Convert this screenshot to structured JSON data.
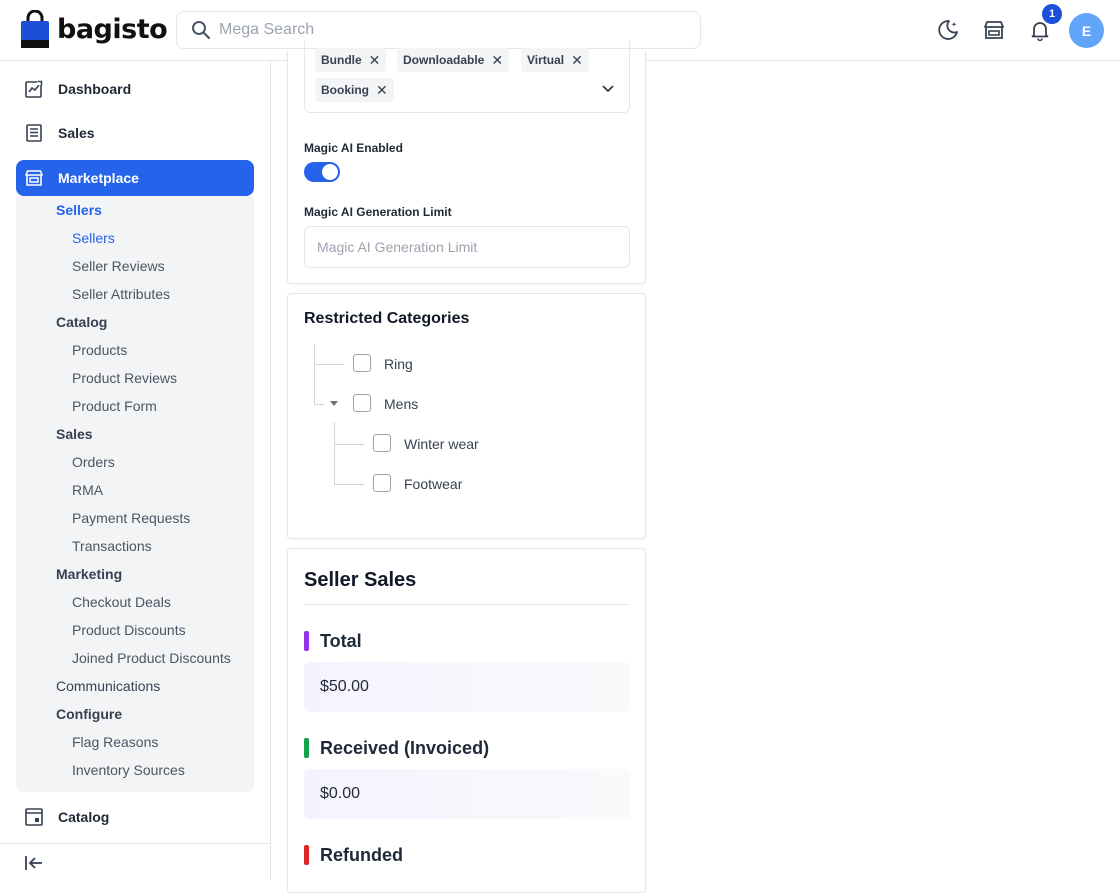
{
  "header": {
    "logo_text": "bagisto",
    "search_placeholder": "Mega Search",
    "notification_count": "1",
    "avatar_initial": "E"
  },
  "sidebar": {
    "top_items": [
      {
        "label": "Dashboard",
        "icon": "dashboard-icon"
      },
      {
        "label": "Sales",
        "icon": "sales-icon"
      },
      {
        "label": "Marketplace",
        "icon": "store-icon",
        "active": true
      }
    ],
    "marketplace_menu": [
      {
        "label": "Sellers",
        "level": 1,
        "active": true
      },
      {
        "label": "Sellers",
        "level": 2,
        "active": true
      },
      {
        "label": "Seller Reviews",
        "level": 2
      },
      {
        "label": "Seller Attributes",
        "level": 2
      },
      {
        "label": "Catalog",
        "level": 1
      },
      {
        "label": "Products",
        "level": 2
      },
      {
        "label": "Product Reviews",
        "level": 2
      },
      {
        "label": "Product Form",
        "level": 2
      },
      {
        "label": "Sales",
        "level": 1
      },
      {
        "label": "Orders",
        "level": 2
      },
      {
        "label": "RMA",
        "level": 2
      },
      {
        "label": "Payment Requests",
        "level": 2
      },
      {
        "label": "Transactions",
        "level": 2
      },
      {
        "label": "Marketing",
        "level": 1
      },
      {
        "label": "Checkout Deals",
        "level": 2
      },
      {
        "label": "Product Discounts",
        "level": 2
      },
      {
        "label": "Joined Product Discounts",
        "level": 2
      },
      {
        "label": "Communications",
        "level": 1
      },
      {
        "label": "Configure",
        "level": 1
      },
      {
        "label": "Flag Reasons",
        "level": 2
      },
      {
        "label": "Inventory Sources",
        "level": 2
      }
    ],
    "bottom_item": {
      "label": "Catalog",
      "icon": "catalog-icon"
    }
  },
  "settings_card": {
    "product_type_tags": [
      "Bundle",
      "Downloadable",
      "Virtual",
      "Booking"
    ],
    "magic_ai_label": "Magic AI Enabled",
    "magic_ai_enabled": true,
    "limit_label": "Magic AI Generation Limit",
    "limit_placeholder": "Magic AI Generation Limit"
  },
  "restricted_categories": {
    "title": "Restricted Categories",
    "items": [
      {
        "label": "Ring",
        "checked": false
      },
      {
        "label": "Mens",
        "checked": false,
        "expanded": true
      },
      {
        "label": "Winter wear",
        "checked": false
      },
      {
        "label": "Footwear",
        "checked": false
      }
    ]
  },
  "seller_sales": {
    "title": "Seller Sales",
    "stats": [
      {
        "label": "Total",
        "value": "$50.00",
        "color": "#9333ea"
      },
      {
        "label": "Received (Invoiced)",
        "value": "$0.00",
        "color": "#16a34a"
      },
      {
        "label": "Refunded",
        "value": "",
        "color": "#dc2626"
      }
    ]
  }
}
